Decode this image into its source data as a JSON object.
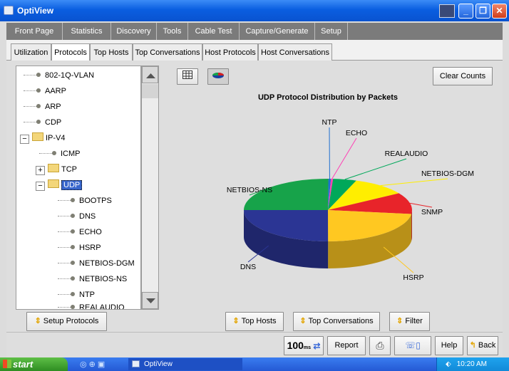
{
  "window": {
    "title": "OptiView"
  },
  "main_tabs": [
    {
      "label": "Front Page"
    },
    {
      "label": "Statistics"
    },
    {
      "label": "Discovery"
    },
    {
      "label": "Tools"
    },
    {
      "label": "Cable Test"
    },
    {
      "label": "Capture/Generate"
    },
    {
      "label": "Setup"
    }
  ],
  "sub_tabs": [
    {
      "label": "Utilization"
    },
    {
      "label": "Protocols",
      "active": true
    },
    {
      "label": "Top Hosts"
    },
    {
      "label": "Top Conversations"
    },
    {
      "label": "Host Protocols"
    },
    {
      "label": "Host Conversations"
    }
  ],
  "tree": [
    {
      "label": "802-1Q-VLAN"
    },
    {
      "label": "AARP"
    },
    {
      "label": "ARP"
    },
    {
      "label": "CDP"
    },
    {
      "label": "IP-V4"
    },
    {
      "label": "ICMP"
    },
    {
      "label": "TCP"
    },
    {
      "label": "UDP"
    },
    {
      "label": "BOOTPS"
    },
    {
      "label": "DNS"
    },
    {
      "label": "ECHO"
    },
    {
      "label": "HSRP"
    },
    {
      "label": "NETBIOS-DGM"
    },
    {
      "label": "NETBIOS-NS"
    },
    {
      "label": "NTP"
    },
    {
      "label": "REALAUDIO"
    }
  ],
  "buttons": {
    "clear_counts": "Clear Counts",
    "setup_protocols": "Setup Protocols",
    "top_hosts": "Top Hosts",
    "top_conversations": "Top Conversations",
    "filter": "Filter"
  },
  "statusbar": {
    "speed": "100",
    "speed_unit": "ms",
    "report": "Report",
    "help": "Help",
    "back": "Back"
  },
  "taskbar": {
    "start": "start",
    "task": "OptiView",
    "time": "10:20 AM"
  },
  "chart_data": {
    "type": "pie",
    "title": "UDP Protocol Distribution by Packets",
    "slices": [
      {
        "label": "NTP",
        "value": 0.5,
        "color": "#1e6fd0"
      },
      {
        "label": "ECHO",
        "value": 0.4,
        "color": "#ff3fb4"
      },
      {
        "label": "REALAUDIO",
        "value": 4.5,
        "color": "#00a85a"
      },
      {
        "label": "NETBIOS-DGM",
        "value": 10.5,
        "color": "#ffee00"
      },
      {
        "label": "SNMP",
        "value": 11.0,
        "color": "#e8242a"
      },
      {
        "label": "HSRP",
        "value": 23.0,
        "color": "#ffc821"
      },
      {
        "label": "DNS",
        "value": 25.0,
        "color": "#2b3594"
      },
      {
        "label": "NETBIOS-NS",
        "value": 25.1,
        "color": "#17a34a"
      }
    ]
  }
}
